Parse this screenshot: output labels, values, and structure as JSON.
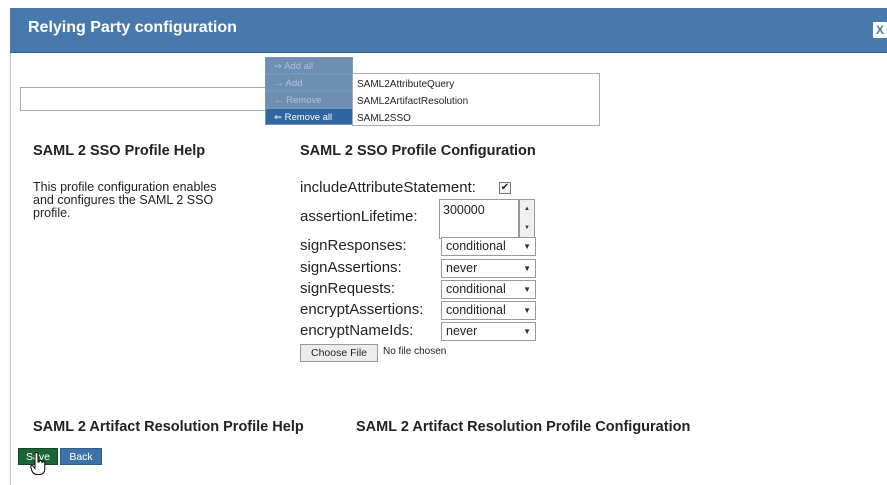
{
  "dialog": {
    "title": "Relying Party configuration",
    "close_glyph": "X"
  },
  "profiles": {
    "buttons": {
      "add_all": "⇒ Add all",
      "add": "→ Add",
      "remove": "← Remove",
      "remove_all": "⇐ Remove all"
    },
    "selected": [
      "SAML2AttributeQuery",
      "SAML2ArtifactResolution",
      "SAML2SSO"
    ]
  },
  "sso_help": {
    "heading": "SAML 2 SSO Profile Help",
    "text": "This profile configuration enables and configures the SAML 2 SSO profile."
  },
  "sso_config": {
    "heading": "SAML 2 SSO Profile Configuration",
    "include_attribute_statement_label": "includeAttributeStatement:",
    "include_attribute_statement_checked": "✔",
    "assertion_lifetime_label": "assertionLifetime:",
    "assertion_lifetime_value": "300000",
    "sign_responses_label": "signResponses:",
    "sign_responses_value": "conditional",
    "sign_assertions_label": "signAssertions:",
    "sign_assertions_value": "never",
    "sign_requests_label": "signRequests:",
    "sign_requests_value": "conditional",
    "encrypt_assertions_label": "encryptAssertions:",
    "encrypt_assertions_value": "conditional",
    "encrypt_nameids_label": "encryptNameIds:",
    "encrypt_nameids_value": "never",
    "choose_file_label": "Choose File",
    "file_status": "No file chosen"
  },
  "artifact": {
    "help_heading": "SAML 2 Artifact Resolution Profile Help",
    "config_heading": "SAML 2 Artifact Resolution Profile Configuration"
  },
  "footer": {
    "save_label": "Save",
    "back_label": "Back"
  },
  "colors": {
    "titlebar": "#4879ad",
    "save": "#1a6637",
    "back": "#3f73a8"
  }
}
